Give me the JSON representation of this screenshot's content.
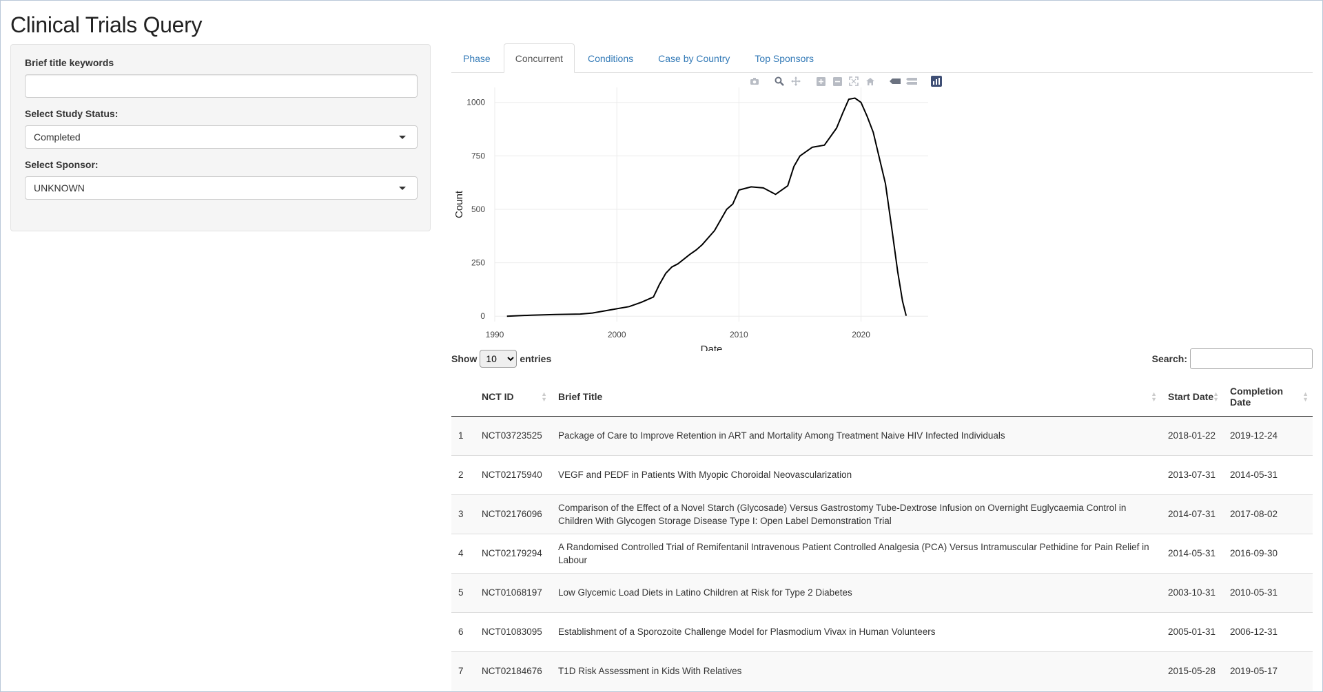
{
  "page": {
    "title": "Clinical Trials Query"
  },
  "sidebar": {
    "keywords": {
      "label": "Brief title keywords",
      "value": "",
      "placeholder": ""
    },
    "status": {
      "label": "Select Study Status:",
      "value": "Completed"
    },
    "sponsor": {
      "label": "Select Sponsor:",
      "value": "UNKNOWN"
    }
  },
  "tabs": [
    {
      "label": "Phase",
      "active": false
    },
    {
      "label": "Concurrent",
      "active": true
    },
    {
      "label": "Conditions",
      "active": false
    },
    {
      "label": "Case by Country",
      "active": false
    },
    {
      "label": "Top Sponsors",
      "active": false
    }
  ],
  "modebar": [
    "camera-icon",
    "zoom-icon",
    "pan-icon",
    "zoom-in-icon",
    "zoom-out-icon",
    "autoscale-icon",
    "reset-axes-icon",
    "hover-closest-icon",
    "hover-compare-icon",
    "plotly-logo-icon"
  ],
  "chart_data": {
    "type": "line",
    "xlabel": "Date",
    "ylabel": "Count",
    "x_ticks": [
      "1990",
      "2000",
      "2010",
      "2020"
    ],
    "y_ticks": [
      "0",
      "250",
      "500",
      "750",
      "1000"
    ],
    "xlim": [
      1990,
      2025.5
    ],
    "ylim": [
      -25,
      1070
    ],
    "grid": true,
    "series": [
      {
        "color": "#000000",
        "x": [
          1991,
          1993,
          1995,
          1997,
          1998,
          1999,
          2000,
          2001,
          2002,
          2003,
          2003.5,
          2004,
          2004.5,
          2005,
          2006,
          2006.5,
          2007,
          2008,
          2009,
          2009.5,
          2010,
          2011,
          2012,
          2013,
          2014,
          2014.5,
          2015,
          2016,
          2017,
          2018,
          2018.5,
          2019,
          2019.5,
          2020,
          2020.5,
          2021,
          2022,
          2022.5,
          2023,
          2023.4,
          2023.7
        ],
        "y": [
          0,
          5,
          8,
          10,
          15,
          25,
          35,
          45,
          65,
          90,
          150,
          200,
          230,
          245,
          290,
          310,
          335,
          400,
          500,
          525,
          590,
          605,
          600,
          570,
          610,
          700,
          750,
          790,
          800,
          880,
          950,
          1015,
          1020,
          1000,
          935,
          860,
          620,
          420,
          210,
          70,
          2
        ]
      }
    ]
  },
  "table": {
    "show_label": "Show",
    "entries_label": "entries",
    "page_size": "10",
    "search_label": "Search:",
    "headers": [
      "",
      "NCT ID",
      "Brief Title",
      "Start Date",
      "Completion Date"
    ],
    "rows": [
      [
        "1",
        "NCT03723525",
        "Package of Care to Improve Retention in ART and Mortality Among Treatment Naive HIV Infected Individuals",
        "2018-01-22",
        "2019-12-24"
      ],
      [
        "2",
        "NCT02175940",
        "VEGF and PEDF in Patients With Myopic Choroidal Neovascularization",
        "2013-07-31",
        "2014-05-31"
      ],
      [
        "3",
        "NCT02176096",
        "Comparison of the Effect of a Novel Starch (Glycosade) Versus Gastrostomy Tube-Dextrose Infusion on Overnight Euglycaemia Control in Children With Glycogen Storage Disease Type I: Open Label Demonstration Trial",
        "2014-07-31",
        "2017-08-02"
      ],
      [
        "4",
        "NCT02179294",
        "A Randomised Controlled Trial of Remifentanil Intravenous Patient Controlled Analgesia (PCA) Versus Intramuscular Pethidine for Pain Relief in Labour",
        "2014-05-31",
        "2016-09-30"
      ],
      [
        "5",
        "NCT01068197",
        "Low Glycemic Load Diets in Latino Children at Risk for Type 2 Diabetes",
        "2003-10-31",
        "2010-05-31"
      ],
      [
        "6",
        "NCT01083095",
        "Establishment of a Sporozoite Challenge Model for Plasmodium Vivax in Human Volunteers",
        "2005-01-31",
        "2006-12-31"
      ],
      [
        "7",
        "NCT02184676",
        "T1D Risk Assessment in Kids With Relatives",
        "2015-05-28",
        "2019-05-17"
      ]
    ]
  }
}
